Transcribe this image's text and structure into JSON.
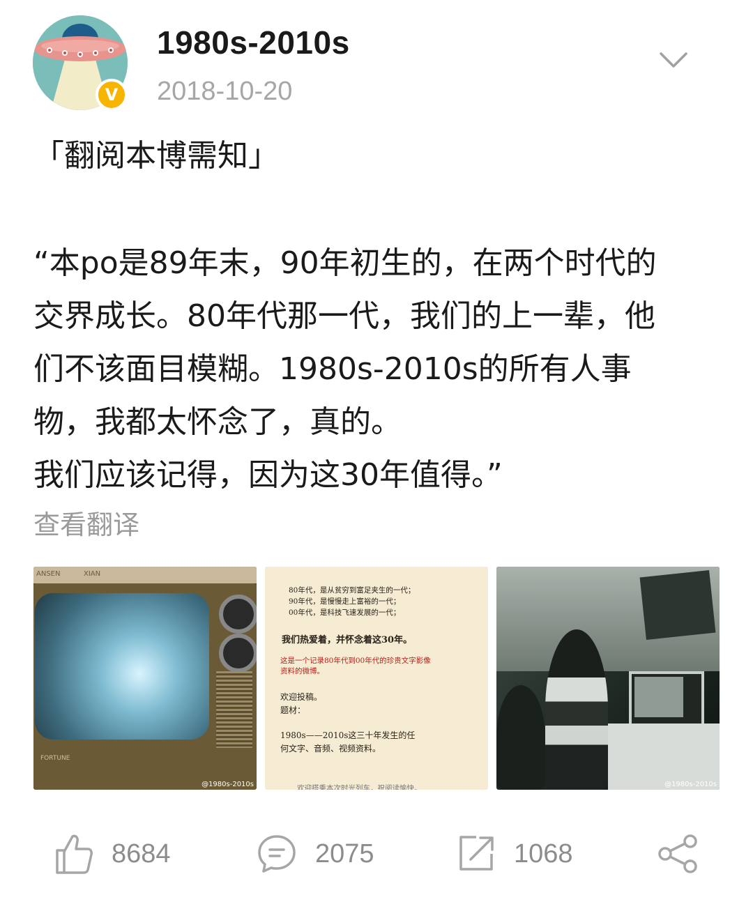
{
  "user": {
    "name": "1980s-2010s",
    "date": "2018-10-20",
    "verified_badge": "V"
  },
  "post": {
    "heading": "「翻阅本博需知」",
    "lines": [
      "“本po是89年末，90年初生的，在两个时代的",
      "交界成长。80年代那一代，我们的上一辈，他",
      "们不该面目模糊。1980s-2010s的所有人事",
      "物，我都太怀念了，真的。",
      "我们应该记得，因为这30年值得。”"
    ],
    "translate_label": "查看翻译"
  },
  "images": {
    "watermark": "@1980s-2010s",
    "poster_lines": [
      "80年代，是从贫穷到富足夹生的一代；",
      "90年代，是慢慢走上富裕的一代；",
      "00年代，是科技飞速发展的一代；",
      "我们热爱着，并怀念着这30年。",
      "这是一个记录80年代到00年代的珍贵文字影像",
      "资料的微博。",
      "欢迎投稿。",
      "题材：",
      "1980s——2010s这三十年发生的任",
      "何文字、音频、视频资料。",
      "欢迎搭乘本次时光列车，祝阅读愉快。"
    ],
    "tv_brand": "ANSEN",
    "tv_label": "XIAN",
    "tv_logo": "FORTUNE"
  },
  "actions": {
    "like_count": "8684",
    "comment_count": "2075",
    "repost_count": "1068"
  },
  "icons": [
    "chevron-down-icon",
    "thumbs-up-icon",
    "comment-icon",
    "repost-icon",
    "share-icon"
  ],
  "colors": {
    "verified": "#f7b500",
    "muted": "#8c8c8c",
    "date": "#a6a6a6"
  }
}
